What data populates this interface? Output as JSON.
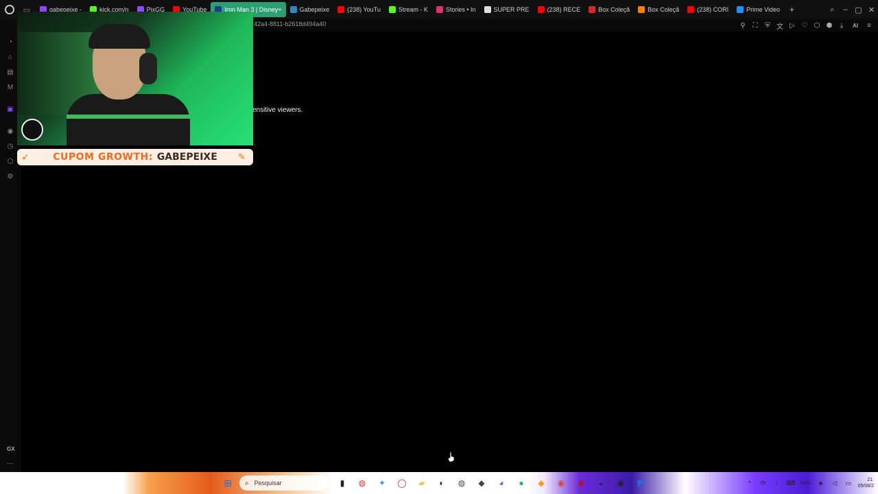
{
  "browser": {
    "tabs": [
      {
        "label": "gabepeixe -",
        "color": "#9146ff",
        "active": false
      },
      {
        "label": "kick.com/n",
        "color": "#53fc18",
        "active": false
      },
      {
        "label": "PixGG",
        "color": "#9146ff",
        "active": false
      },
      {
        "label": "YouTube",
        "color": "#ff0000",
        "active": false
      },
      {
        "label": "Iron Man 3 | Disney+",
        "color": "#1e3a8a",
        "active": true
      },
      {
        "label": "Gabepeixe",
        "color": "#2f86c9",
        "active": false
      },
      {
        "label": "(238) YouTu",
        "color": "#ff0000",
        "active": false
      },
      {
        "label": "Stream - K",
        "color": "#53fc18",
        "active": false
      },
      {
        "label": "Stories • In",
        "color": "#e1306c",
        "active": false
      },
      {
        "label": "SUPER PRE",
        "color": "#dddddd",
        "active": false
      },
      {
        "label": "(238) RECE",
        "color": "#ff0000",
        "active": false
      },
      {
        "label": "Box Coleçã",
        "color": "#d62828",
        "active": false
      },
      {
        "label": "Box Coleçã",
        "color": "#f77f00",
        "active": false
      },
      {
        "label": "(238) CORI",
        "color": "#ff0000",
        "active": false
      },
      {
        "label": "Prime Video",
        "color": "#1e90ff",
        "active": false
      }
    ],
    "new_tab": "+",
    "url": "42a4-8811-b2618d494a40",
    "address_icons": [
      "pin-icon",
      "snapshot-icon",
      "shield-icon",
      "translate-icon",
      "play-icon",
      "heart-icon",
      "extensions-icon",
      "cube-icon",
      "download-icon",
      "aria-icon",
      "menu-icon"
    ],
    "aria_label": "AI"
  },
  "overlay": {
    "coupon_prefix": "CUPOM GROWTH:",
    "coupon_code": "GABEPEIXE"
  },
  "page": {
    "notice": "ensitive viewers."
  },
  "sidebar": {
    "gx_label": "GX",
    "more_label": "···"
  },
  "taskbar": {
    "search_placeholder": "Pesquisar",
    "lang": "ENG",
    "clock_time": "21:",
    "clock_date": "05/08/2"
  }
}
